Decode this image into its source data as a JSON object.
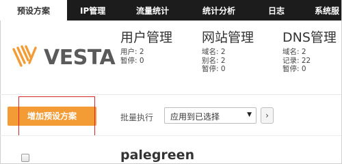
{
  "nav": {
    "tabs": [
      {
        "label": "预设方案",
        "active": true
      },
      {
        "label": "IP管理",
        "active": false
      },
      {
        "label": "流量统计",
        "active": false
      },
      {
        "label": "统计分析",
        "active": false
      },
      {
        "label": "日志",
        "active": false
      },
      {
        "label": "系统服",
        "active": false
      }
    ]
  },
  "logo": {
    "text": "VESTA",
    "icon": "vesta-logo-icon",
    "color": "#f39b34"
  },
  "stats": [
    {
      "title": "用户管理",
      "lines": [
        "用户: 2",
        "暂停: 0"
      ]
    },
    {
      "title": "网站管理",
      "lines": [
        "域名: 2",
        "别名: 2",
        "暂停: 0"
      ]
    },
    {
      "title": "DNS管理",
      "lines": [
        "域名: 2",
        "记录: 22",
        "暂停: 0"
      ]
    }
  ],
  "toolbar": {
    "add_label": "增加预设方案",
    "bulk_label": "批量执行",
    "bulk_selected": "应用到已选择",
    "apply_label": "›"
  },
  "rows": [
    {
      "name": "palegreen"
    }
  ],
  "colors": {
    "accent": "#f39b34",
    "nav_bg": "#1c1c1c",
    "highlight": "#d9262b"
  }
}
